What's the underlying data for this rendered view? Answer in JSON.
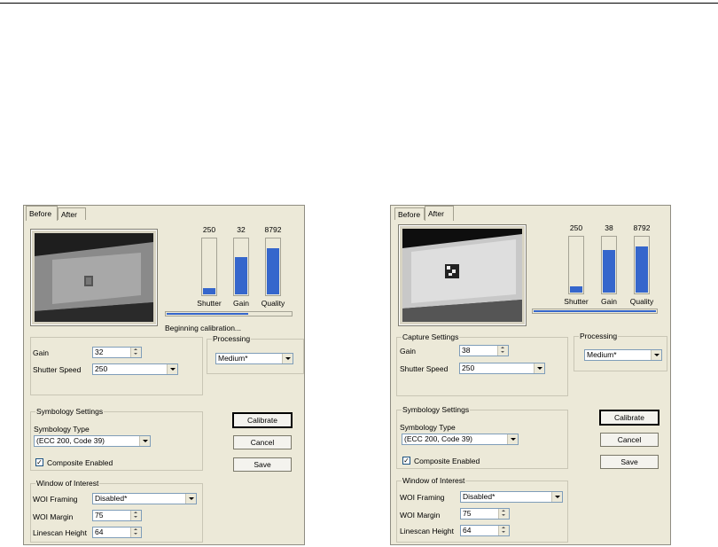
{
  "before": {
    "tabs": [
      {
        "label": "Before"
      },
      {
        "label": "After"
      }
    ],
    "bars": [
      {
        "value": "250",
        "label": "Shutter",
        "level": 0.14
      },
      {
        "value": "32",
        "label": "Gain",
        "level": 0.68
      },
      {
        "value": "8792",
        "label": "Quality",
        "level": 0.84
      }
    ],
    "progress": 0.66,
    "status": "Beginning calibration...",
    "gain_group": {
      "gain_label": "Gain",
      "gain_value": "32",
      "shutter_label": "Shutter Speed",
      "shutter_value": "250"
    },
    "processing": {
      "title": "Processing",
      "value": "Medium*"
    },
    "symbology": {
      "title": "Symbology Settings",
      "type_label": "Symbology Type",
      "type_value": "(ECC 200, Code 39)",
      "checkbox_label": "Composite Enabled",
      "checked": true
    },
    "buttons": {
      "calibrate": "Calibrate",
      "cancel": "Cancel",
      "save": "Save"
    },
    "woi": {
      "title": "Window of Interest",
      "framing_label": "WOI Framing",
      "framing_value": "Disabled*",
      "margin_label": "WOI Margin",
      "margin_value": "75",
      "linescan_label": "Linescan Height",
      "linescan_value": "64"
    }
  },
  "after": {
    "tabs": [
      {
        "label": "Before"
      },
      {
        "label": "After"
      }
    ],
    "bars": [
      {
        "value": "250",
        "label": "Shutter",
        "level": 0.14
      },
      {
        "value": "38",
        "label": "Gain",
        "level": 0.78
      },
      {
        "value": "8792",
        "label": "Quality",
        "level": 0.84
      }
    ],
    "progress": 1.0,
    "capture_group": {
      "title": "Capture Settings",
      "gain_label": "Gain",
      "gain_value": "38",
      "shutter_label": "Shutter Speed",
      "shutter_value": "250"
    },
    "processing": {
      "title": "Processing",
      "value": "Medium*"
    },
    "symbology": {
      "title": "Symbology Settings",
      "type_label": "Symbology Type",
      "type_value": "(ECC 200, Code 39)",
      "checkbox_label": "Composite Enabled",
      "checked": true
    },
    "buttons": {
      "calibrate": "Calibrate",
      "cancel": "Cancel",
      "save": "Save"
    },
    "woi": {
      "title": "Window of Interest",
      "framing_label": "WOI Framing",
      "framing_value": "Disabled*",
      "margin_label": "WOI Margin",
      "margin_value": "75",
      "linescan_label": "Linescan Height",
      "linescan_value": "64"
    }
  }
}
